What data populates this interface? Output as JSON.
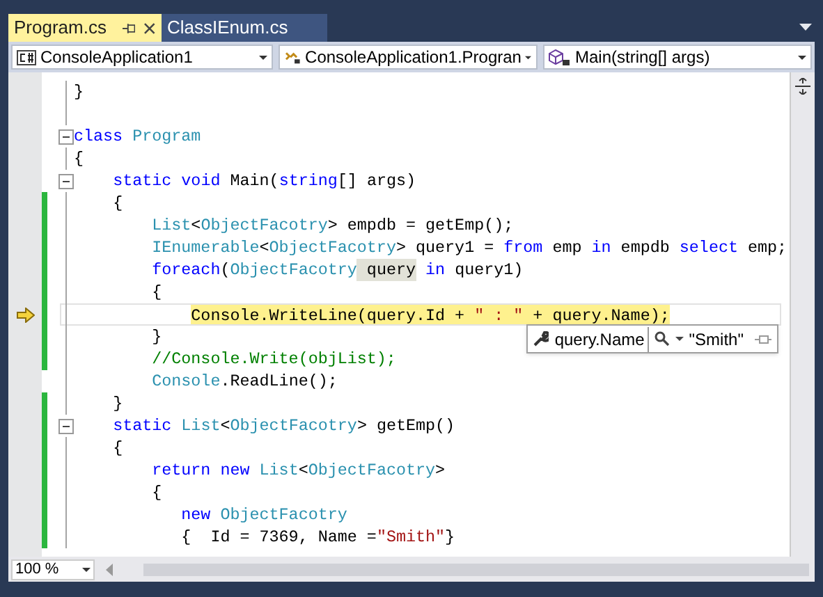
{
  "tabs": [
    {
      "label": "Program.cs",
      "selected": true
    },
    {
      "label": "ClassIEnum.cs",
      "selected": false
    }
  ],
  "nav": [
    {
      "kind": "project",
      "text": "ConsoleApplication1"
    },
    {
      "kind": "class",
      "text": "ConsoleApplication1.Progran"
    },
    {
      "kind": "method",
      "text": "Main(string[] args)"
    }
  ],
  "lines": [
    {
      "changed": false,
      "current": false,
      "fold": false,
      "tokens": [
        {
          "kind": "plain",
          "text": "}"
        }
      ]
    },
    {
      "changed": false,
      "current": false,
      "fold": false
    },
    {
      "changed": false,
      "current": false,
      "fold": true,
      "tokens": [
        {
          "kind": "kw",
          "text": "class"
        },
        {
          "kind": "type",
          "text": " Program"
        }
      ]
    },
    {
      "changed": false,
      "current": false,
      "fold": false,
      "tokens": [
        {
          "kind": "plain",
          "text": "{"
        }
      ]
    },
    {
      "changed": false,
      "current": false,
      "fold": true,
      "tokens": [
        {
          "kind": "kw",
          "text": "    static"
        },
        {
          "kind": "kw",
          "text": " void"
        },
        {
          "kind": "plain",
          "text": " Main("
        },
        {
          "kind": "kw",
          "text": "string"
        },
        {
          "kind": "plain",
          "text": "[] args)"
        }
      ]
    },
    {
      "changed": true,
      "current": false,
      "fold": false,
      "tokens": [
        {
          "kind": "plain",
          "text": "    {"
        }
      ]
    },
    {
      "changed": true,
      "current": false,
      "fold": false,
      "tokens": [
        {
          "kind": "type",
          "text": "        List"
        },
        {
          "kind": "plain",
          "text": "<"
        },
        {
          "kind": "type",
          "text": "ObjectFacotry"
        },
        {
          "kind": "plain",
          "text": "> empdb = getEmp();"
        }
      ]
    },
    {
      "changed": true,
      "current": false,
      "fold": false,
      "tokens": [
        {
          "kind": "type",
          "text": "        IEnumerable"
        },
        {
          "kind": "plain",
          "text": "<"
        },
        {
          "kind": "type",
          "text": "ObjectFacotry"
        },
        {
          "kind": "plain",
          "text": "> query1 = "
        },
        {
          "kind": "kw",
          "text": "from"
        },
        {
          "kind": "plain",
          "text": " emp "
        },
        {
          "kind": "kw",
          "text": "in"
        },
        {
          "kind": "plain",
          "text": " empdb "
        },
        {
          "kind": "kw",
          "text": "select"
        },
        {
          "kind": "plain",
          "text": " emp;"
        }
      ]
    },
    {
      "changed": true,
      "current": false,
      "fold": false,
      "tokens": [
        {
          "kind": "kw",
          "text": "        foreach"
        },
        {
          "kind": "plain",
          "text": "("
        },
        {
          "kind": "type",
          "text": "ObjectFacotry"
        },
        {
          "kind": "ref",
          "text": " query"
        },
        {
          "kind": "kw",
          "text": " in"
        },
        {
          "kind": "plain",
          "text": " query1)"
        }
      ]
    },
    {
      "changed": true,
      "current": false,
      "fold": false,
      "tokens": [
        {
          "kind": "plain",
          "text": "        {"
        }
      ]
    },
    {
      "changed": true,
      "current": true,
      "fold": false,
      "tokens": [
        {
          "kind": "plain",
          "text": "            Console.WriteLine(query.Id + "
        },
        {
          "kind": "str",
          "text": "\" : \""
        },
        {
          "kind": "plain",
          "text": " + query.Name);"
        }
      ]
    },
    {
      "changed": true,
      "current": false,
      "fold": false,
      "tokens": [
        {
          "kind": "plain",
          "text": "        }"
        }
      ]
    },
    {
      "changed": true,
      "current": false,
      "fold": false,
      "tokens": [
        {
          "kind": "comment",
          "text": "        //Console.Write(objList);"
        }
      ]
    },
    {
      "changed": false,
      "current": false,
      "fold": false,
      "tokens": [
        {
          "kind": "type",
          "text": "        Console"
        },
        {
          "kind": "plain",
          "text": ".ReadLine();"
        }
      ]
    },
    {
      "changed": true,
      "current": false,
      "fold": false,
      "tokens": [
        {
          "kind": "plain",
          "text": "    }"
        }
      ]
    },
    {
      "changed": true,
      "current": false,
      "fold": true,
      "tokens": [
        {
          "kind": "kw",
          "text": "    static"
        },
        {
          "kind": "type",
          "text": " List"
        },
        {
          "kind": "plain",
          "text": "<"
        },
        {
          "kind": "type",
          "text": "ObjectFacotry"
        },
        {
          "kind": "plain",
          "text": "> getEmp()"
        }
      ]
    },
    {
      "changed": true,
      "current": false,
      "fold": false,
      "tokens": [
        {
          "kind": "plain",
          "text": "    {"
        }
      ]
    },
    {
      "changed": true,
      "current": false,
      "fold": false,
      "tokens": [
        {
          "kind": "kw",
          "text": "        return"
        },
        {
          "kind": "kw",
          "text": " new"
        },
        {
          "kind": "type",
          "text": " List"
        },
        {
          "kind": "plain",
          "text": "<"
        },
        {
          "kind": "type",
          "text": "ObjectFacotry"
        },
        {
          "kind": "plain",
          "text": ">"
        }
      ]
    },
    {
      "changed": true,
      "current": false,
      "fold": false,
      "tokens": [
        {
          "kind": "plain",
          "text": "        {"
        }
      ]
    },
    {
      "changed": true,
      "current": false,
      "fold": false,
      "tokens": [
        {
          "kind": "kw",
          "text": "           new"
        },
        {
          "kind": "type",
          "text": " ObjectFacotry"
        }
      ]
    },
    {
      "changed": true,
      "current": false,
      "fold": false,
      "tokens": [
        {
          "kind": "plain",
          "text": "           {  Id = 7369, Name ="
        },
        {
          "kind": "str",
          "text": "\"Smith\""
        },
        {
          "kind": "plain",
          "text": "}"
        }
      ]
    }
  ],
  "datatip": {
    "expression": "query.Name",
    "value": "\"Smith\""
  },
  "zoom": "100 %"
}
